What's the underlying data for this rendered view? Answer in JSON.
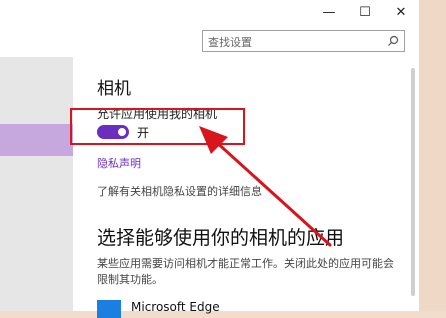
{
  "window": {
    "minimize_label": "—",
    "maximize_label": "☐",
    "close_label": "✕"
  },
  "search": {
    "placeholder": "查找设置"
  },
  "camera": {
    "title": "相机",
    "allow_label": "允许应用使用我的相机",
    "toggle_state": "开",
    "privacy_link": "隐私声明",
    "privacy_info": "了解有关相机隐私设置的详细信息"
  },
  "apps": {
    "title": "选择能够使用你的相机的应用",
    "description": "某些应用需要访问相机才能正常工作。关闭此处的应用可能会限制其功能。",
    "first_app_name": "Microsoft Edge"
  },
  "colors": {
    "accent": "#6b2fbf",
    "annotation": "#d8141c",
    "left_selected": "#c6a8df"
  }
}
